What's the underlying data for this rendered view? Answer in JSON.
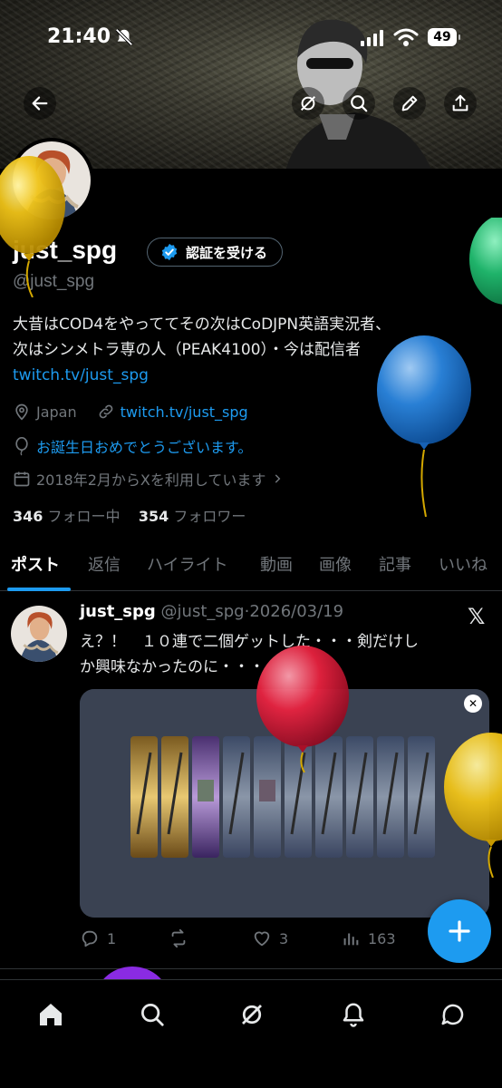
{
  "status_bar": {
    "time": "21:40",
    "battery": "49"
  },
  "profile": {
    "name": "just_spg",
    "handle": "@just_spg",
    "verify_button": "認証を受ける",
    "bio_line1": "大昔はCOD4をやっててその次はCoDJPN英語実況者、",
    "bio_line2": "次はシンメトラ専の人（PEAK4100）・今は配信者",
    "bio_link": "twitch.tv/just_spg",
    "location": "Japan",
    "website": "twitch.tv/just_spg",
    "birthday": "お誕生日おめでとうございます。",
    "joined": "2018年2月からXを利用しています",
    "following_count": "346",
    "following_label": "フォロー中",
    "followers_count": "354",
    "followers_label": "フォロワー"
  },
  "tabs": [
    {
      "label": "ポスト"
    },
    {
      "label": "返信"
    },
    {
      "label": "ハイライト"
    },
    {
      "label": "動画"
    },
    {
      "label": "画像"
    },
    {
      "label": "記事"
    },
    {
      "label": "いいね"
    }
  ],
  "post": {
    "name": "just_spg",
    "handle": "@just_spg",
    "separator": "·",
    "date": "2026/03/19",
    "text_line1": "え？！　１０連で二個ゲットした・・・剣だけし",
    "text_line2": "か興味なかったのに・・・",
    "replies": "1",
    "likes": "3",
    "views": "163"
  },
  "colors": {
    "accent": "#1d9bf0",
    "background": "#000000",
    "muted_text": "#71767b",
    "balloon_yellow": "#e6b800",
    "balloon_blue": "#1f7fd6",
    "balloon_green": "#1fb36a",
    "balloon_red": "#e8223f",
    "balloon_purple": "#8a2be2"
  },
  "icons": {
    "back": "arrow-left-icon",
    "grok": "grok-icon",
    "search": "search-icon",
    "edit": "pencil-icon",
    "share": "share-icon",
    "location": "location-pin-icon",
    "link": "link-icon",
    "birthday": "balloon-icon",
    "calendar": "calendar-icon",
    "reply": "reply-icon",
    "repost": "repost-icon",
    "like": "heart-icon",
    "views": "views-icon",
    "compose": "plus-icon",
    "home": "home-icon",
    "explore": "search-icon",
    "notifications": "bell-icon",
    "messages": "message-icon"
  }
}
